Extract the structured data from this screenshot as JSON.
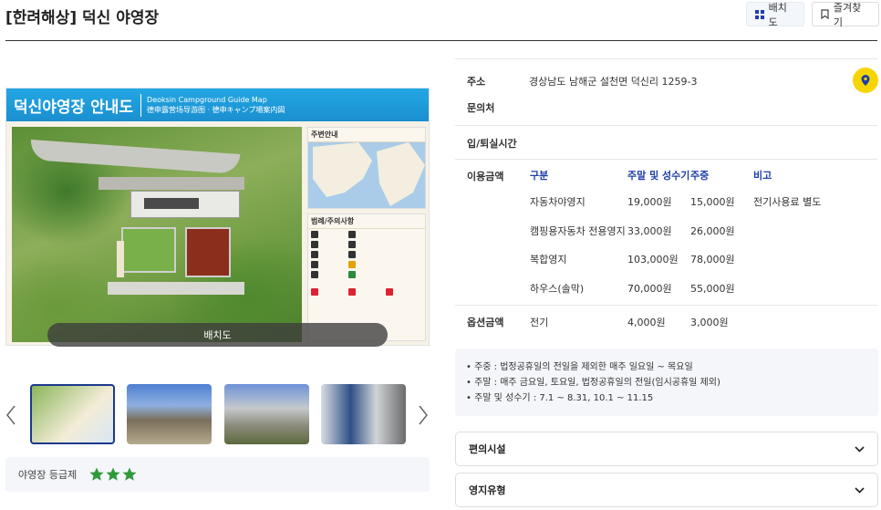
{
  "page": {
    "title": "[한려해상] 덕신 야영장"
  },
  "header": {
    "layout_btn": "배치도",
    "bookmark_btn": "즐겨찾기"
  },
  "gallery": {
    "map_title_ko": "덕신야영장 안내도",
    "map_title_en": "Deoksin Campground Guide Map",
    "map_title_cn": "德申露营场导游图 · 德申キャンプ場案内図",
    "side_nearby": "주변안내",
    "side_legend": "범례/주의사항",
    "caption": "배치도",
    "prev_icon": "chevron-left-icon",
    "next_icon": "chevron-right-icon"
  },
  "grade": {
    "label": "야영장 등급제",
    "stars": 3,
    "star_color": "#2e9a3a"
  },
  "info": {
    "address_label": "주소",
    "address": "경상남도 남해군 설천면 덕신리 1259-3",
    "contact_label": "문의처",
    "checkin_label": "입/퇴실시간",
    "fee_label": "이용금액",
    "option_label": "옵션금액",
    "headers": [
      "구분",
      "주말 및 성수기",
      "주중",
      "비고"
    ],
    "rows": [
      {
        "type": "자동차야영지",
        "weekend": "19,000원",
        "weekday": "15,000원",
        "note": "전기사용료 별도"
      },
      {
        "type": "캠핑용자동차 전용영지",
        "weekend": "33,000원",
        "weekday": "26,000원",
        "note": ""
      },
      {
        "type": "복합영지",
        "weekend": "103,000원",
        "weekday": "78,000원",
        "note": ""
      },
      {
        "type": "하우스(솔막)",
        "weekend": "70,000원",
        "weekday": "55,000원",
        "note": ""
      }
    ],
    "option_row": {
      "type": "전기",
      "weekend": "4,000원",
      "weekday": "3,000원"
    }
  },
  "notes": [
    "• 주중 : 법정공휴일의 전일을 제외한 매주 일요일 ~ 목요일",
    "• 주말 : 매주 금요일, 토요일, 법정공휴일의 전일(임시공휴일 제외)",
    "• 주말 및 성수기 : 7.1 ~ 8.31, 10.1 ~ 11.15"
  ],
  "accordions": [
    {
      "label": "편의시설"
    },
    {
      "label": "영지유형"
    }
  ],
  "colors": {
    "accent": "#1e3ea8",
    "pin": "#f7d500"
  }
}
